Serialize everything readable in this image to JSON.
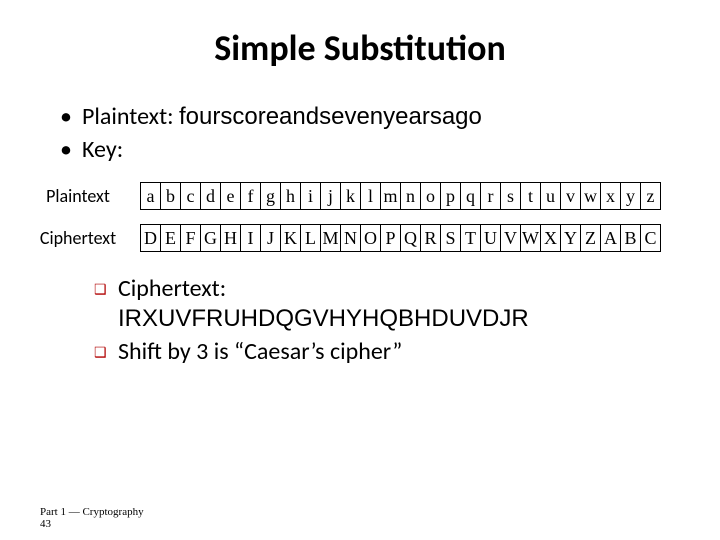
{
  "title": "Simple Substitution",
  "bullet_plaintext_label": "Plaintext: ",
  "bullet_plaintext_value": "fourscoreandsevenyearsago",
  "bullet_key_label": "Key:",
  "row_labels": {
    "plain": "Plaintext",
    "cipher": "Ciphertext"
  },
  "plain_alpha": [
    "a",
    "b",
    "c",
    "d",
    "e",
    "f",
    "g",
    "h",
    "i",
    "j",
    "k",
    "l",
    "m",
    "n",
    "o",
    "p",
    "q",
    "r",
    "s",
    "t",
    "u",
    "v",
    "w",
    "x",
    "y",
    "z"
  ],
  "cipher_alpha": [
    "D",
    "E",
    "F",
    "G",
    "H",
    "I",
    "J",
    "K",
    "L",
    "M",
    "N",
    "O",
    "P",
    "Q",
    "R",
    "S",
    "T",
    "U",
    "V",
    "W",
    "X",
    "Y",
    "Z",
    "A",
    "B",
    "C"
  ],
  "sub_bullets": {
    "ciphertext_label": "Ciphertext:",
    "ciphertext_value": "IRXUVFRUHDQGVHYHQBHDUVDJR",
    "shift_text": "Shift by 3 is “Caesar’s cipher”"
  },
  "footer": "Part 1 — Cryptography\n43",
  "chart_data": {
    "type": "table",
    "title": "Caesar shift-by-3 substitution key",
    "columns": [
      "plaintext_letter",
      "ciphertext_letter"
    ],
    "rows": [
      [
        "a",
        "D"
      ],
      [
        "b",
        "E"
      ],
      [
        "c",
        "F"
      ],
      [
        "d",
        "G"
      ],
      [
        "e",
        "H"
      ],
      [
        "f",
        "I"
      ],
      [
        "g",
        "J"
      ],
      [
        "h",
        "K"
      ],
      [
        "i",
        "L"
      ],
      [
        "j",
        "M"
      ],
      [
        "k",
        "N"
      ],
      [
        "l",
        "O"
      ],
      [
        "m",
        "P"
      ],
      [
        "n",
        "Q"
      ],
      [
        "o",
        "R"
      ],
      [
        "p",
        "S"
      ],
      [
        "q",
        "T"
      ],
      [
        "r",
        "U"
      ],
      [
        "s",
        "V"
      ],
      [
        "t",
        "W"
      ],
      [
        "u",
        "X"
      ],
      [
        "v",
        "Y"
      ],
      [
        "w",
        "Z"
      ],
      [
        "x",
        "A"
      ],
      [
        "y",
        "B"
      ],
      [
        "z",
        "C"
      ]
    ]
  }
}
